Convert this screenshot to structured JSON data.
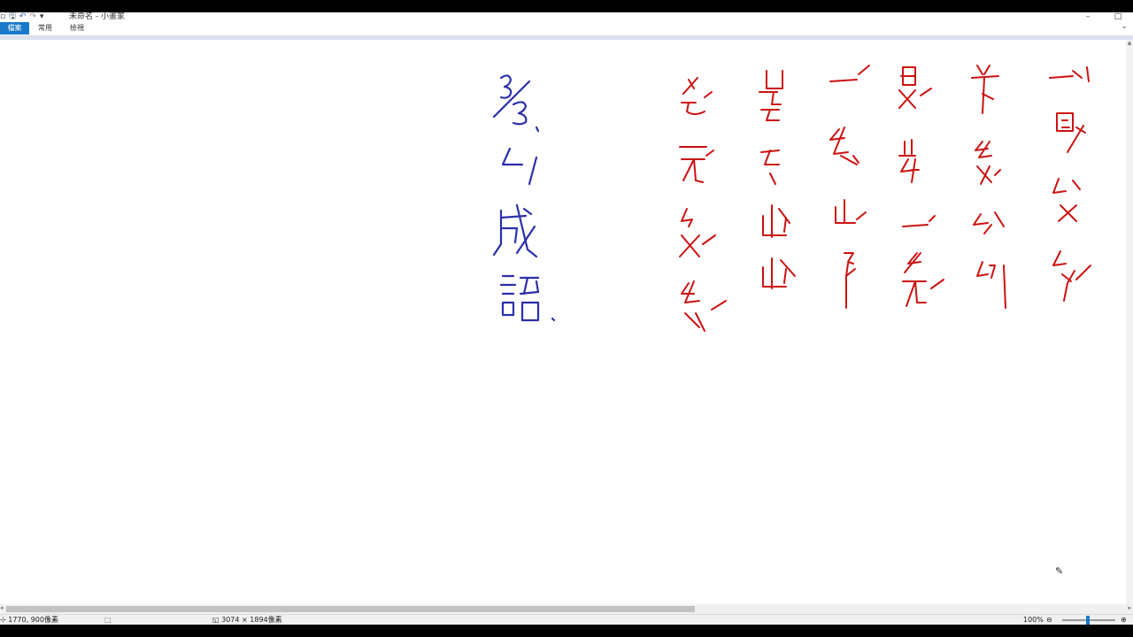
{
  "window": {
    "title": "未命名 - 小畫家",
    "buttons": {
      "minimize": "–",
      "maximize": "□"
    }
  },
  "ribbon": {
    "tabs": [
      {
        "label": "檔案"
      },
      {
        "label": "常用"
      },
      {
        "label": "檢視"
      }
    ],
    "collapse_icon": "chevron-down-icon"
  },
  "colors": {
    "file_tab": "#1979ca",
    "blue_ink": "#2b2fa8",
    "red_ink": "#cc1111"
  },
  "status": {
    "cursor_position": "1770, 900像素",
    "image_size": "3074 × 1894像素",
    "zoom": "100%",
    "zoom_out": "⊖",
    "zoom_in": "⊕",
    "zoom_level": 0.5
  }
}
